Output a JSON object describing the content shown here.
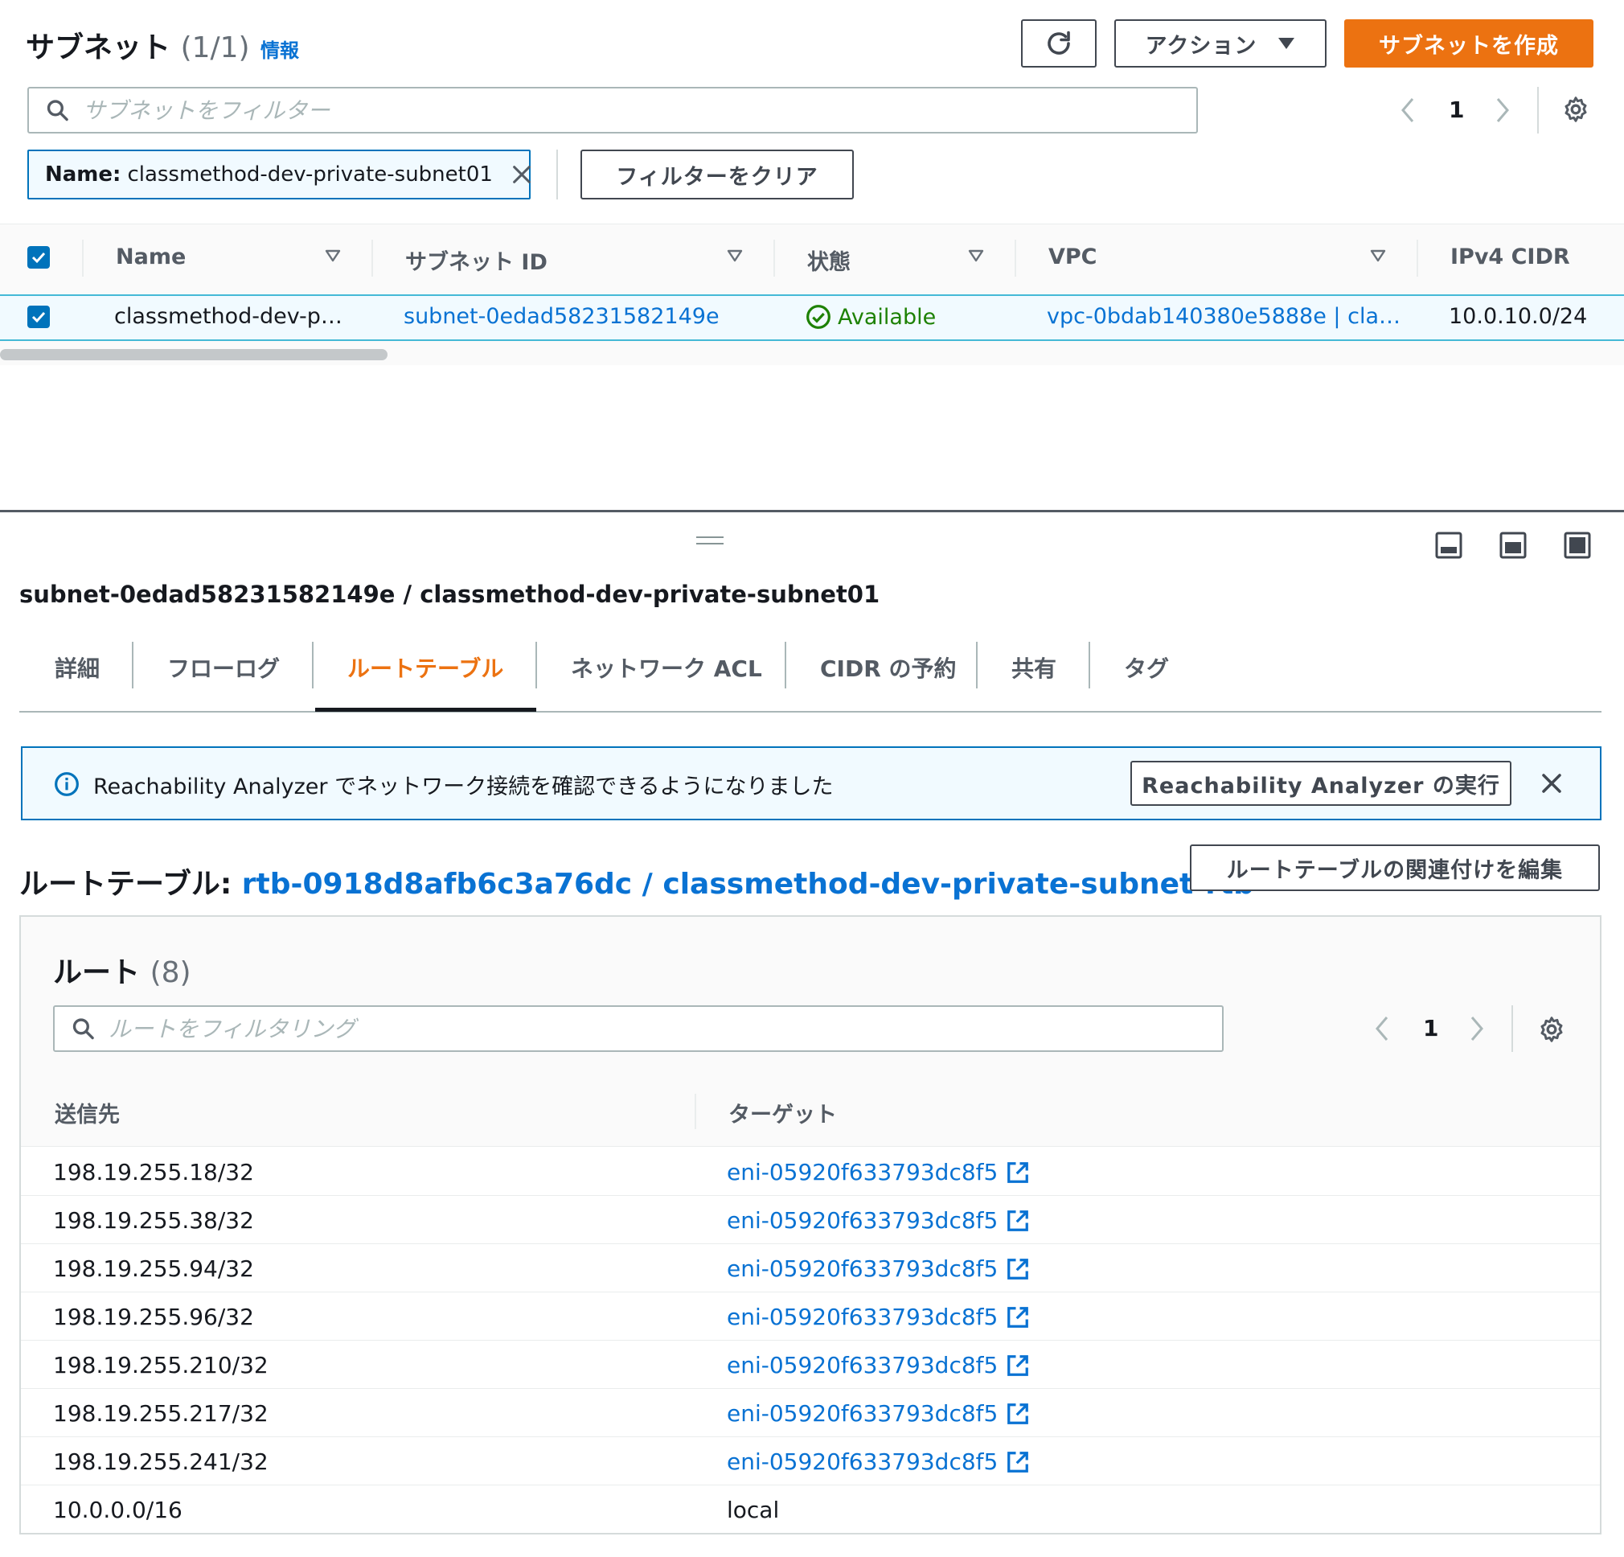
{
  "header": {
    "title": "サブネット",
    "count": "(1/1)",
    "info_link": "情報",
    "actions_label": "アクション",
    "create_label": "サブネットを作成",
    "search_placeholder": "サブネットをフィルター",
    "page": "1",
    "filter_token_key": "Name:",
    "filter_token_value": "classmethod-dev-private-subnet01",
    "clear_filter_label": "フィルターをクリア"
  },
  "subnet_table": {
    "columns": [
      "Name",
      "サブネット ID",
      "状態",
      "VPC",
      "IPv4 CIDR"
    ],
    "row": {
      "name": "classmethod-dev-p…",
      "subnet_id": "subnet-0edad58231582149e",
      "state": "Available",
      "vpc": "vpc-0bdab140380e5888e | cla…",
      "cidr": "10.0.10.0/24"
    }
  },
  "detail": {
    "title": "subnet-0edad58231582149e / classmethod-dev-private-subnet01",
    "tabs": [
      "詳細",
      "フローログ",
      "ルートテーブル",
      "ネットワーク ACL",
      "CIDR の予約",
      "共有",
      "タグ"
    ],
    "flash_text": "Reachability Analyzer でネットワーク接続を確認できるようになりました",
    "flash_button": "Reachability Analyzer の実行",
    "route_table_label": "ルートテーブル:",
    "route_table_link": "rtb-0918d8afb6c3a76dc / classmethod-dev-private-subnet-rtb",
    "edit_assoc_button": "ルートテーブルの関連付けを編集"
  },
  "routes": {
    "title": "ルート",
    "count": "(8)",
    "search_placeholder": "ルートをフィルタリング",
    "page": "1",
    "columns": [
      "送信先",
      "ターゲット"
    ],
    "rows": [
      {
        "dest": "198.19.255.18/32",
        "target": "eni-05920f633793dc8f5"
      },
      {
        "dest": "198.19.255.38/32",
        "target": "eni-05920f633793dc8f5"
      },
      {
        "dest": "198.19.255.94/32",
        "target": "eni-05920f633793dc8f5"
      },
      {
        "dest": "198.19.255.96/32",
        "target": "eni-05920f633793dc8f5"
      },
      {
        "dest": "198.19.255.210/32",
        "target": "eni-05920f633793dc8f5"
      },
      {
        "dest": "198.19.255.217/32",
        "target": "eni-05920f633793dc8f5"
      },
      {
        "dest": "198.19.255.241/32",
        "target": "eni-05920f633793dc8f5"
      },
      {
        "dest": "10.0.0.0/16",
        "target": "local"
      }
    ]
  },
  "colors": {
    "primary": "#ec7211",
    "link": "#0972d3",
    "success": "#1d8102",
    "selected_border": "#44b9d6"
  }
}
